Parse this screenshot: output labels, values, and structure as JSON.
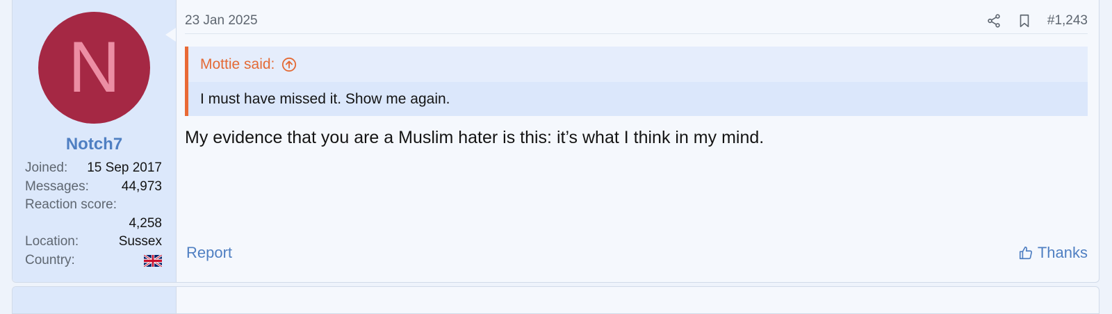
{
  "user": {
    "avatar_letter": "N",
    "avatar_color": "#a52844",
    "username": "Notch7",
    "stats": {
      "joined_label": "Joined:",
      "joined_value": "15 Sep 2017",
      "messages_label": "Messages:",
      "messages_value": "44,973",
      "reaction_label": "Reaction score:",
      "reaction_value": "4,258",
      "location_label": "Location:",
      "location_value": "Sussex",
      "country_label": "Country:",
      "country_flag": "uk-flag-icon"
    }
  },
  "post": {
    "date": "23 Jan 2025",
    "number": "#1,243",
    "quote": {
      "author_label": "Mottie said:",
      "text": "I must have missed it. Show me again."
    },
    "message": "My evidence that you are a Muslim hater is this: it’s what I think in my mind.",
    "report_label": "Report",
    "thanks_label": "Thanks"
  },
  "colors": {
    "accent": "#4f7fc2",
    "quote_accent": "#e96a35",
    "sidebar_bg": "#dce8fb",
    "post_bg": "#f5f8fd"
  }
}
